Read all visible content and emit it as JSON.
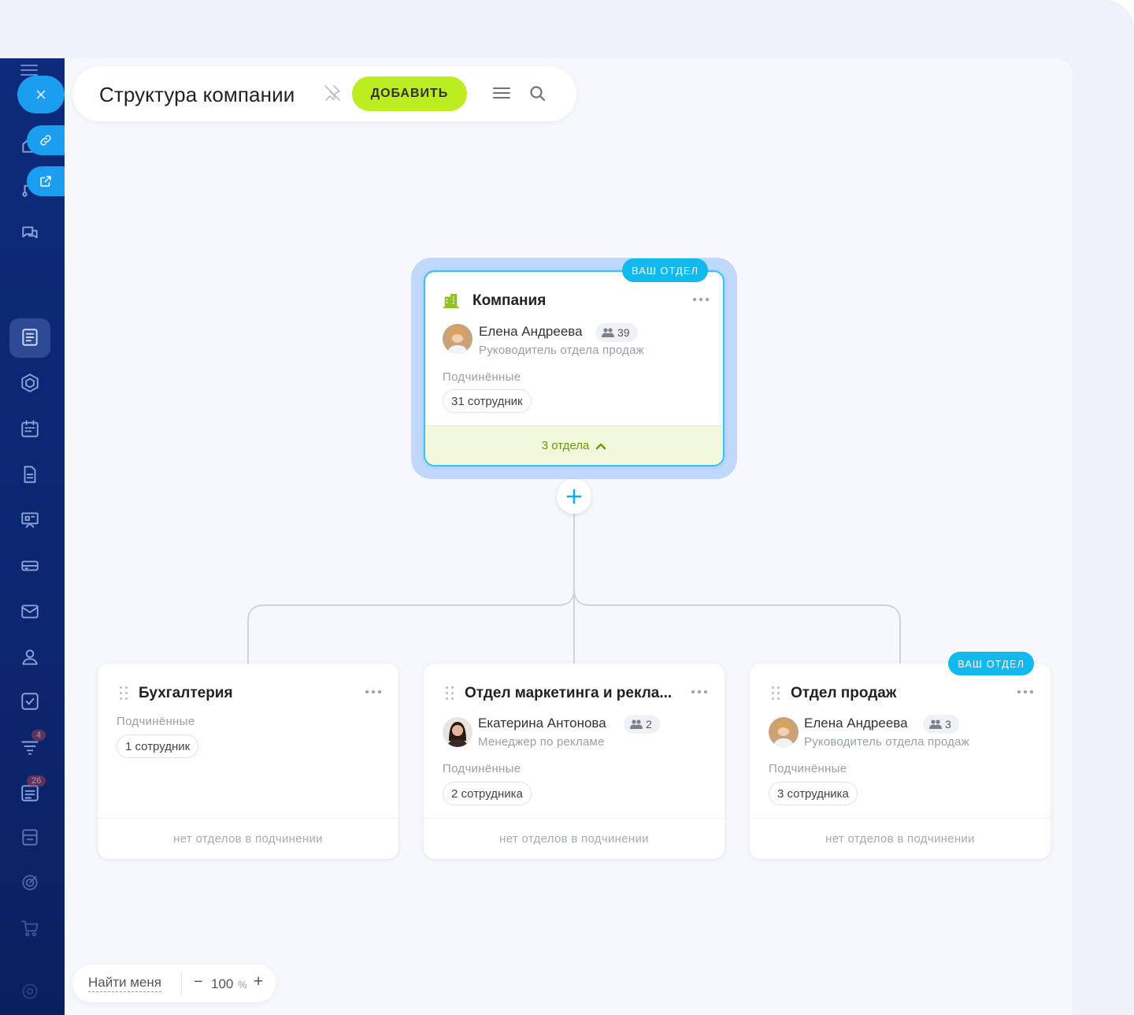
{
  "topbar": {
    "title": "Структура компании",
    "add_label": "ДОБАВИТЬ",
    "icons": [
      "pin-icon",
      "menu-icon",
      "search-icon"
    ]
  },
  "root": {
    "tag": "ВАШ ОТДЕЛ",
    "title": "Компания",
    "head_name": "Елена Андреева",
    "head_count": "39",
    "head_role": "Руководитель отдела продаж",
    "subordinates_label": "Подчинённые",
    "subordinates": "31 сотрудник",
    "departments": "3 отдела"
  },
  "departments": [
    {
      "title": "Бухгалтерия",
      "subordinates_label": "Подчинённые",
      "subordinates": "1 сотрудник",
      "footer": "нет отделов в подчинении"
    },
    {
      "title": "Отдел маркетинга и рекла...",
      "head_name": "Екатерина Антонова",
      "head_count": "2",
      "head_role": "Менеджер по рекламе",
      "subordinates_label": "Подчинённые",
      "subordinates": "2 сотрудника",
      "footer": "нет отделов в подчинении"
    },
    {
      "tag": "ВАШ ОТДЕЛ",
      "title": "Отдел продаж",
      "head_name": "Елена Андреева",
      "head_count": "3",
      "head_role": "Руководитель отдела продаж",
      "subordinates_label": "Подчинённые",
      "subordinates": "3 сотрудника",
      "footer": "нет отделов в подчинении"
    }
  ],
  "bottombar": {
    "find_me": "Найти меня",
    "zoom_value": "100",
    "zoom_unit": "%",
    "zoom_minus": "−",
    "zoom_plus": "+"
  },
  "sidebar": {
    "badges": [
      "4",
      "26"
    ]
  },
  "colors": {
    "accent": "#11b9ef",
    "add_button": "#bbed21",
    "sidebar": "#0d2b7a",
    "root_footer_text": "#6a9a08"
  }
}
